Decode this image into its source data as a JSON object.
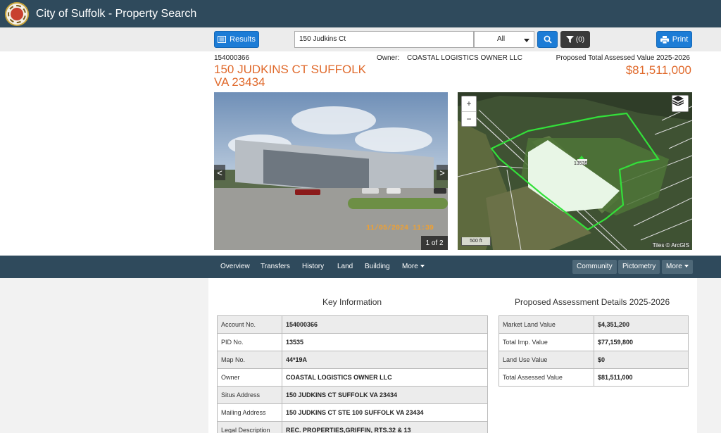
{
  "app": {
    "title": "City of Suffolk - Property Search"
  },
  "toolbar": {
    "results_label": "Results",
    "search_value": "150 Judkins Ct",
    "search_type": "All",
    "filter_label": "(0)",
    "print_label": "Print"
  },
  "property": {
    "account_no": "154000366",
    "owner_label": "Owner:",
    "owner": "COASTAL LOGISTICS OWNER LLC",
    "assessed_label": "Proposed Total Assessed Value 2025-2026",
    "address": "150 JUDKINS CT SUFFOLK VA 23434",
    "assessed_value": "$81,511,000"
  },
  "photo": {
    "prev_label": "<",
    "next_label": ">",
    "counter": "1 of 2",
    "timestamp": "11/05/2024 11:39"
  },
  "map": {
    "zoom_in": "+",
    "zoom_out": "−",
    "parcel_label": "13535",
    "scale": "500 ft",
    "attribution": "Tiles © ArcGIS"
  },
  "tabs": {
    "left": [
      "Overview",
      "Transfers",
      "History",
      "Land",
      "Building",
      "More"
    ],
    "right": [
      "Community",
      "Pictometry",
      "More"
    ]
  },
  "key_info": {
    "title": "Key Information",
    "rows": [
      {
        "label": "Account No.",
        "value": "154000366"
      },
      {
        "label": "PID No.",
        "value": "13535"
      },
      {
        "label": "Map No.",
        "value": "44*19A"
      },
      {
        "label": "Owner",
        "value": "COASTAL LOGISTICS OWNER LLC"
      },
      {
        "label": "Situs Address",
        "value": "150 JUDKINS CT SUFFOLK VA 23434"
      },
      {
        "label": "Mailing Address",
        "value": "150 JUDKINS CT STE 100 SUFFOLK VA 23434"
      },
      {
        "label": "Legal Description",
        "value": "REC. PROPERTIES,GRIFFIN, RTS.32 & 13"
      }
    ]
  },
  "assessment": {
    "title": "Proposed Assessment Details 2025-2026",
    "rows": [
      {
        "label": "Market Land Value",
        "value": "$4,351,200"
      },
      {
        "label": "Total Imp. Value",
        "value": "$77,159,800"
      },
      {
        "label": "Land Use Value",
        "value": "$0"
      },
      {
        "label": "Total Assessed Value",
        "value": "$81,511,000"
      }
    ]
  },
  "colors": {
    "header": "#2f4a5c",
    "accent_blue": "#1c7cd6",
    "address_orange": "#e06a2c"
  },
  "icons": [
    "city-seal-icon",
    "list-icon",
    "search-icon",
    "filter-icon",
    "printer-icon",
    "layers-icon"
  ]
}
